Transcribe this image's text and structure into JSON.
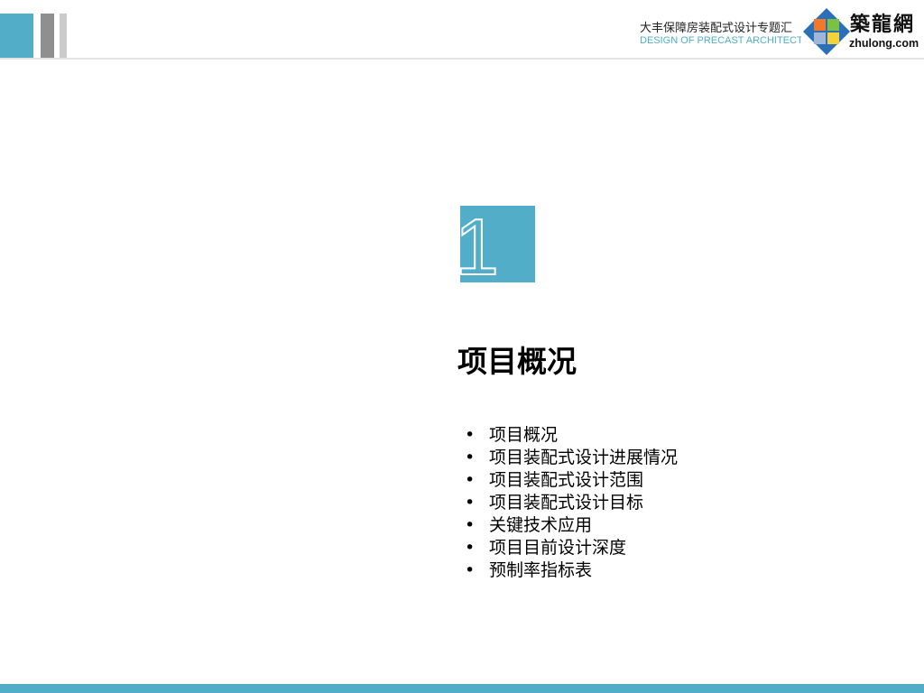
{
  "header": {
    "title": "大丰保障房装配式设计专题汇",
    "subtitle": "DESIGN OF PRECAST ARCHITECTURE",
    "logo": {
      "text_cn": "築龍網",
      "text_en": "zhulong.com"
    }
  },
  "section": {
    "number": "1",
    "title": "项目概况",
    "items": [
      "项目概况",
      "项目装配式设计进展情况",
      "项目装配式设计范围",
      "项目装配式设计目标",
      "关键技术应用",
      "项目目前设计深度",
      "预制率指标表"
    ]
  },
  "colors": {
    "accent": "#51adc8",
    "gray": "#8f8f8f",
    "light_gray": "#cccccc"
  }
}
